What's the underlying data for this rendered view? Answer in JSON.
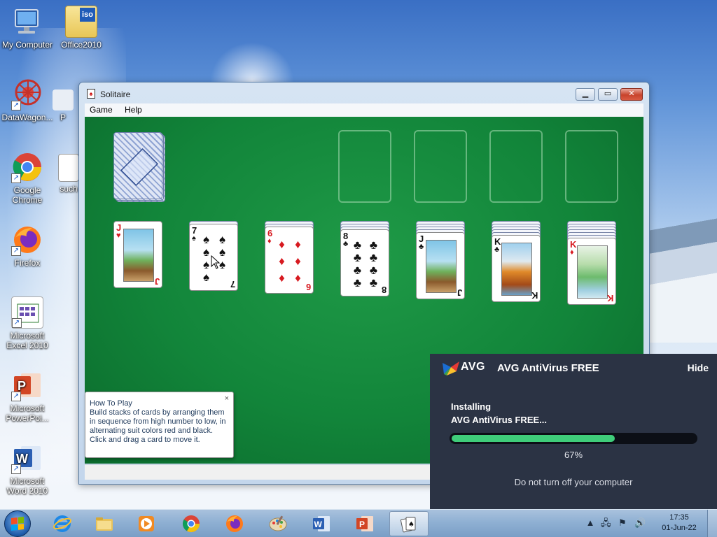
{
  "desktop": {
    "icons": [
      {
        "label": "My Computer"
      },
      {
        "label": "Office2010"
      },
      {
        "label": "DataWagon..."
      },
      {
        "label": "P"
      },
      {
        "label": "Google Chrome"
      },
      {
        "label": "such"
      },
      {
        "label": "Firefox"
      },
      {
        "label": "Microsoft Excel 2010"
      },
      {
        "label": "Microsoft PowerPoi..."
      },
      {
        "label": "Microsoft Word 2010"
      }
    ],
    "office_badge": "iso"
  },
  "window": {
    "title": "Solitaire",
    "menu": [
      "Game",
      "Help"
    ],
    "buttons": {
      "minimize": "▁",
      "maximize": "▭",
      "close": "✕"
    }
  },
  "game": {
    "tableau": [
      {
        "rank": "J",
        "suit": "♥",
        "color": "red",
        "face": true
      },
      {
        "rank": "7",
        "suit": "♠",
        "color": "black",
        "face": false
      },
      {
        "rank": "6",
        "suit": "♦",
        "color": "red",
        "face": false
      },
      {
        "rank": "8",
        "suit": "♣",
        "color": "black",
        "face": false
      },
      {
        "rank": "J",
        "suit": "♣",
        "color": "black",
        "face": true
      },
      {
        "rank": "K",
        "suit": "♣",
        "color": "black",
        "face": true
      },
      {
        "rank": "K",
        "suit": "♦",
        "color": "red",
        "face": true
      }
    ]
  },
  "tip": {
    "title": "How To Play",
    "body": "Build stacks of cards by arranging them in sequence from high number to low, in alternating suit colors red and black. Click and drag a card to move it.",
    "close": "×"
  },
  "avg": {
    "logo_text": "AVG",
    "title": "AVG AntiVirus FREE",
    "hide": "Hide",
    "status_line1": "Installing",
    "status_line2": "AVG AntiVirus FREE...",
    "progress_fraction": 0.67,
    "progress_text": "67%",
    "footer": "Do not turn off your computer",
    "colors": {
      "panel": "#2b3344",
      "bar": "#3fcd7a"
    }
  },
  "taskbar": {
    "apps": [
      "internet-explorer",
      "file-explorer",
      "media-player",
      "chrome",
      "firefox",
      "paint",
      "word",
      "powerpoint",
      "solitaire"
    ],
    "time": "17:35",
    "date": "01-Jun-22",
    "tray": [
      "show-hidden-icons",
      "network",
      "action-center",
      "volume"
    ]
  }
}
